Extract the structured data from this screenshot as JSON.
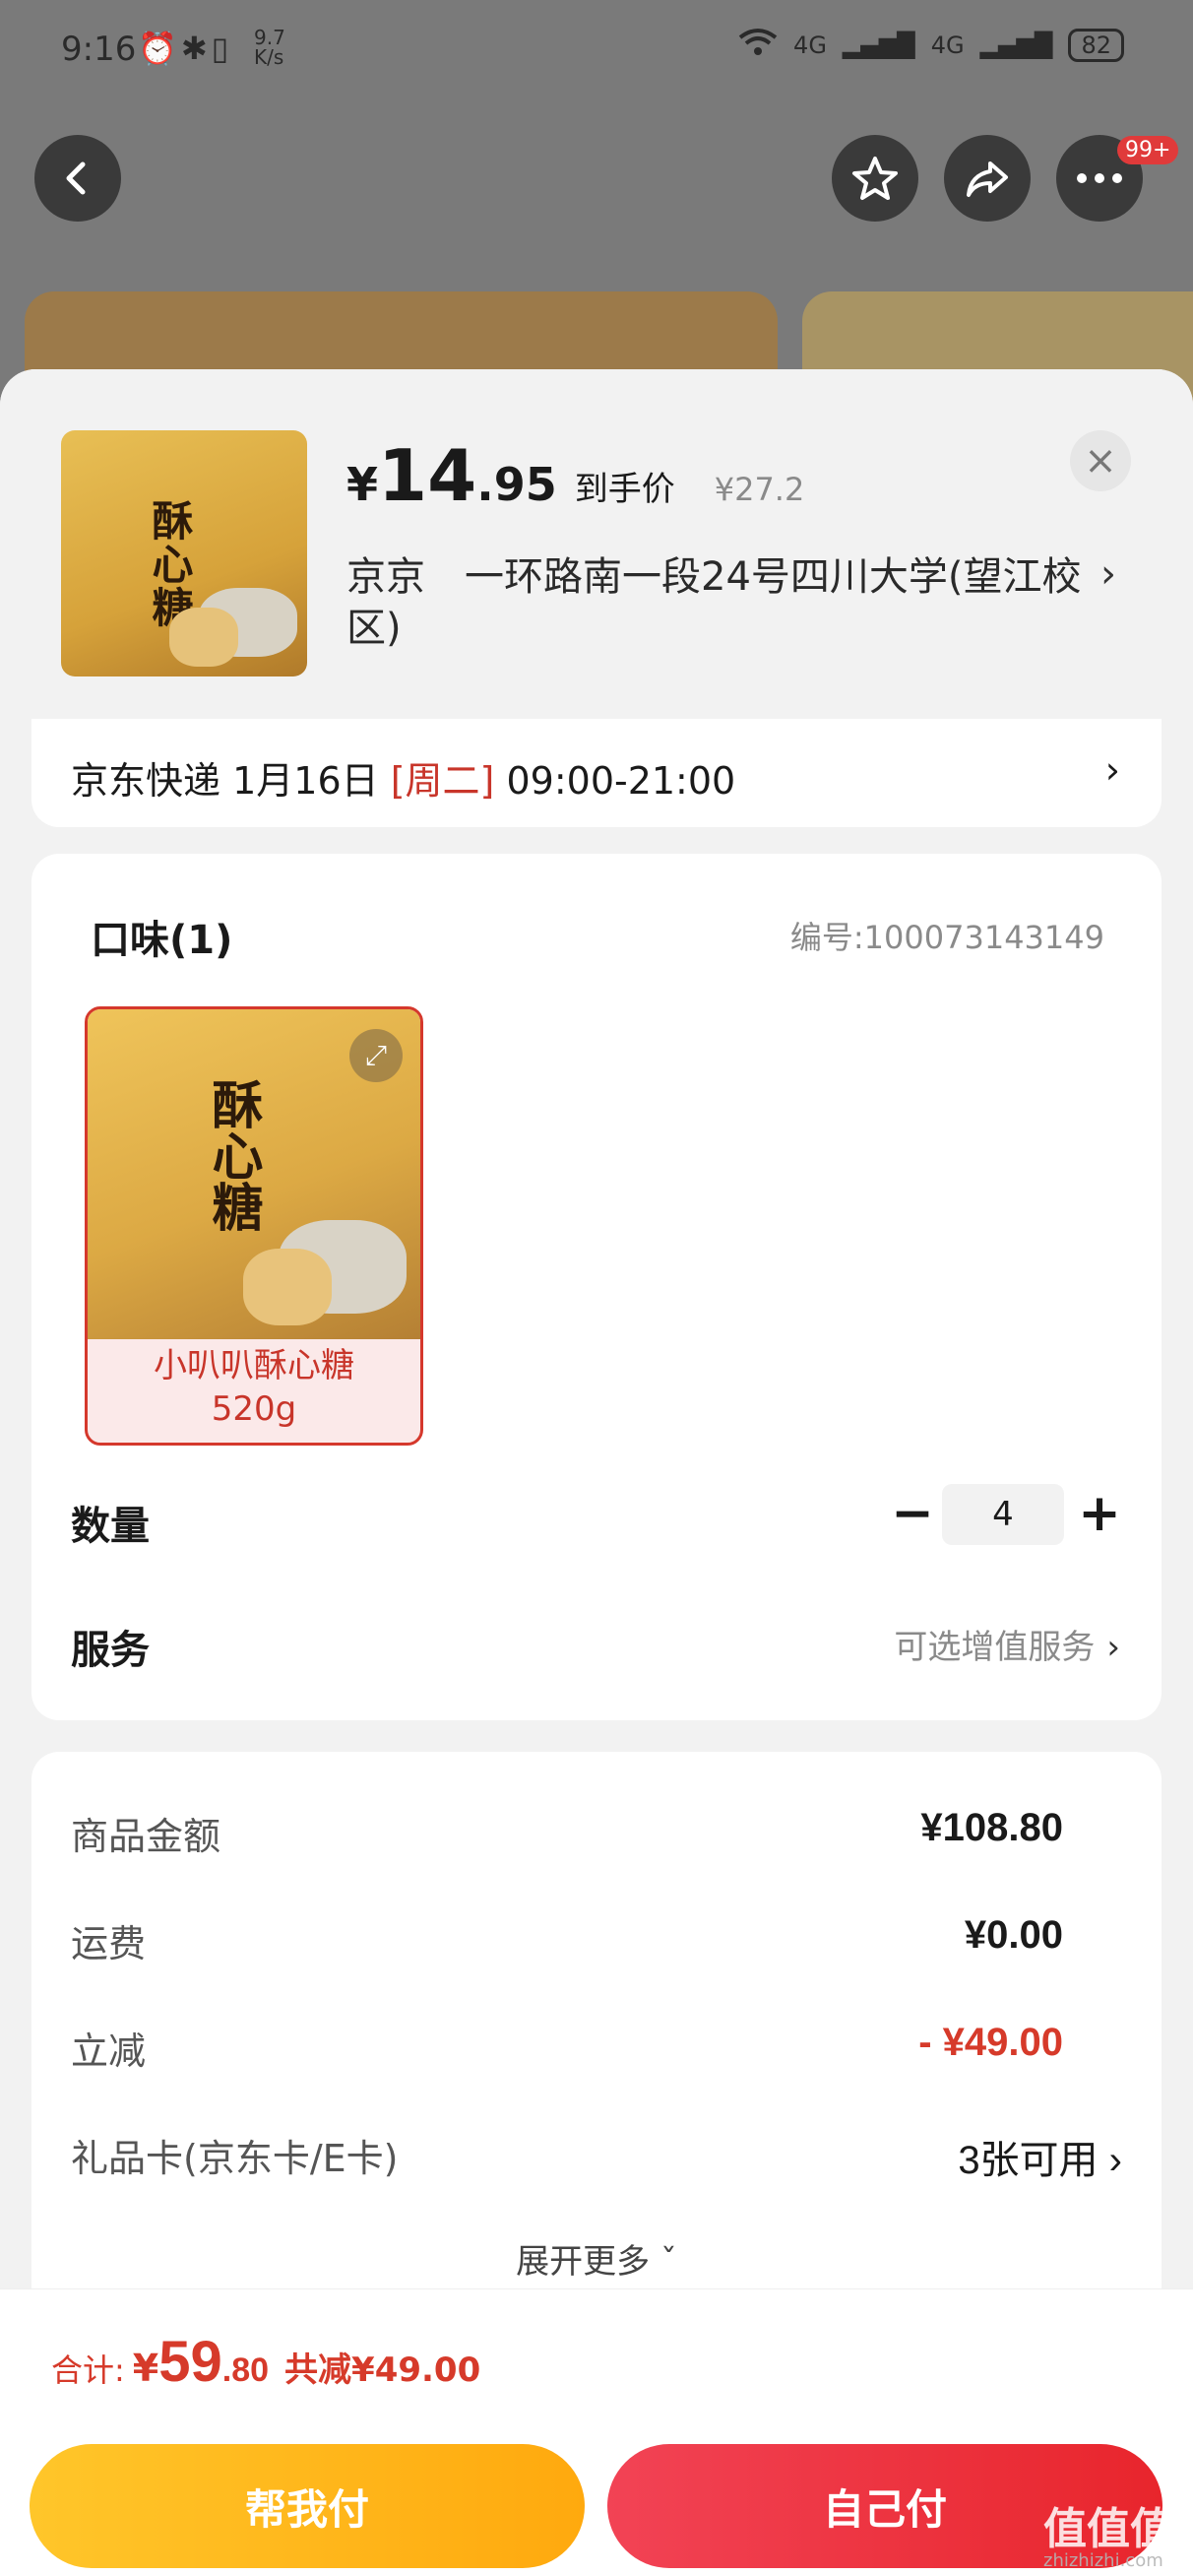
{
  "status_bar": {
    "time": "9:16",
    "speed_value": "9.7",
    "speed_unit": "K/s",
    "net1": "4G",
    "net2": "4G",
    "battery": "82"
  },
  "nav": {
    "badge": "99+"
  },
  "product": {
    "price_yen": "¥",
    "price_int": "14",
    "price_dec": ".95",
    "price_label": "到手价",
    "original_price": "¥27.2",
    "thumb_text": "酥心糖",
    "address": "京京　一环路南一段24号四川大学(望江校区)",
    "address_arrow": "›"
  },
  "shipping": {
    "carrier": "京东快递",
    "date": "1月16日",
    "weekday": "[周二]",
    "time_window": "09:00-21:00",
    "arrow": "›"
  },
  "flavor": {
    "title": "口味(1)",
    "sku_no": "编号:100073143149",
    "option_name": "小叭叭酥心糖",
    "option_spec": "520g",
    "option_img_text": "酥心糖"
  },
  "quantity": {
    "label": "数量",
    "minus": "−",
    "value": "4",
    "plus": "+"
  },
  "service": {
    "label": "服务",
    "value": "可选增值服务",
    "arrow": "›"
  },
  "summary": {
    "rows": [
      {
        "label": "商品金额",
        "value": "¥108.80"
      },
      {
        "label": "运费",
        "value": "¥0.00"
      },
      {
        "label": "立减",
        "value": "- ¥49.00"
      },
      {
        "label": "礼品卡(京东卡/E卡)",
        "value": "3张可用 ›"
      }
    ],
    "expand_more": "展开更多 ˇ"
  },
  "total": {
    "label": "合计:",
    "yen": "¥",
    "int": "59",
    "dec": ".80",
    "saved": "共减¥49.00"
  },
  "actions": {
    "help_pay": "帮我付",
    "self_pay": "自己付"
  },
  "watermark": {
    "text": "值值值",
    "sub": "zhizhizhi.com"
  },
  "colors": {
    "accent_red": "#d63a2a",
    "help_btn": "#ffb81c",
    "self_btn": "#ec2f3b"
  }
}
